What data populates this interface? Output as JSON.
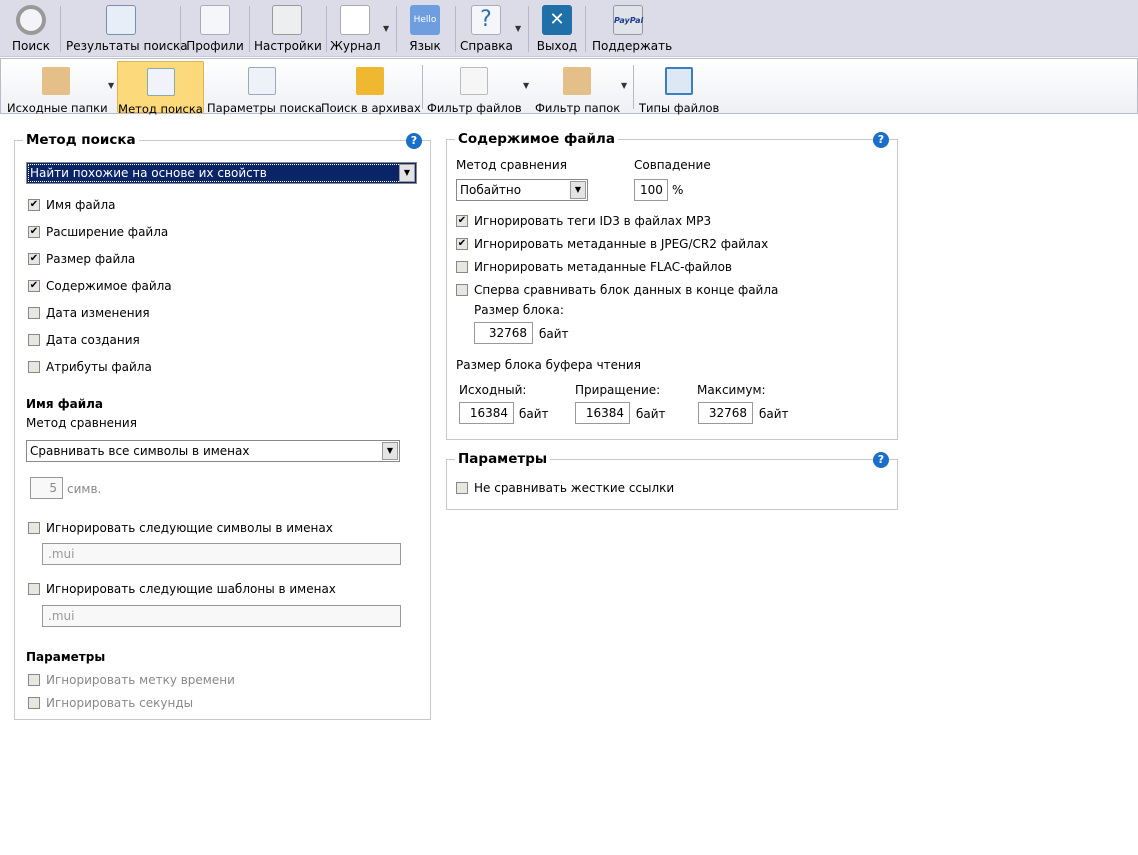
{
  "toolbar_main": [
    {
      "label": "Поиск",
      "icon": "search-icon"
    },
    {
      "label": "Результаты поиска",
      "icon": "save-results-icon"
    },
    {
      "label": "Профили",
      "icon": "profile-icon"
    },
    {
      "label": "Настройки",
      "icon": "settings-icon"
    },
    {
      "label": "Журнал",
      "icon": "log-icon"
    },
    {
      "label": "Язык",
      "icon": "language-icon",
      "icon_text": "Hello"
    },
    {
      "label": "Справка",
      "icon": "help-icon",
      "icon_text": "?"
    },
    {
      "label": "Выход",
      "icon": "exit-icon",
      "icon_text": "✕"
    },
    {
      "label": "Поддержать",
      "icon": "paypal-icon",
      "icon_text": "PayPal"
    }
  ],
  "toolbar_secondary": [
    {
      "label": "Исходные папки",
      "icon": "folder-search-icon"
    },
    {
      "label": "Метод поиска",
      "icon": "search-method-icon"
    },
    {
      "label": "Параметры поиска",
      "icon": "search-params-icon"
    },
    {
      "label": "Поиск в архивах",
      "icon": "archive-icon"
    },
    {
      "label": "Фильтр файлов",
      "icon": "file-filter-icon"
    },
    {
      "label": "Фильтр папок",
      "icon": "folder-filter-icon"
    },
    {
      "label": "Типы файлов",
      "icon": "file-types-icon"
    }
  ],
  "method": {
    "title": "Метод поиска",
    "mode": "Найти похожие на основе их свойств",
    "options": [
      {
        "label": "Имя файла",
        "checked": true
      },
      {
        "label": "Расширение файла",
        "checked": true
      },
      {
        "label": "Размер файла",
        "checked": true
      },
      {
        "label": "Содержимое файла",
        "checked": true
      },
      {
        "label": "Дата изменения",
        "checked": false
      },
      {
        "label": "Дата создания",
        "checked": false
      },
      {
        "label": "Атрибуты файла",
        "checked": false
      }
    ],
    "filename_header": "Имя файла",
    "compare_label": "Метод сравнения",
    "compare_value": "Сравнивать все символы в именах",
    "chars_value": "5",
    "chars_unit": "симв.",
    "ignore_chars_label": "Игнорировать следующие символы в именах",
    "ignore_chars_value": ".mui",
    "ignore_patterns_label": "Игнорировать следующие шаблоны в именах",
    "ignore_patterns_value": ".mui",
    "params_header": "Параметры",
    "ignore_time": "Игнорировать метку времени",
    "ignore_seconds": "Игнорировать секунды"
  },
  "content": {
    "title": "Содержимое файла",
    "compare_label": "Метод сравнения",
    "compare_value": "Побайтно",
    "match_label": "Совпадение",
    "match_value": "100",
    "match_unit": "%",
    "options": [
      {
        "label": "Игнорировать теги ID3 в файлах MP3",
        "checked": true
      },
      {
        "label": "Игнорировать метаданные в JPEG/CR2 файлах",
        "checked": true
      },
      {
        "label": "Игнорировать метаданные FLAC-файлов",
        "checked": false
      },
      {
        "label": "Сперва сравнивать блок данных в конце файла",
        "checked": false
      }
    ],
    "block_label": "Размер блока:",
    "block_value": "32768",
    "unit": "байт",
    "buffer_label": "Размер блока буфера чтения",
    "initial_label": "Исходный:",
    "initial_value": "16384",
    "increment_label": "Приращение:",
    "increment_value": "16384",
    "max_label": "Максимум:",
    "max_value": "32768"
  },
  "params": {
    "title": "Параметры",
    "hardlinks": "Не сравнивать жесткие ссылки"
  },
  "help_glyph": "?",
  "check_glyph": "✔",
  "dropdown_glyph": "▼"
}
